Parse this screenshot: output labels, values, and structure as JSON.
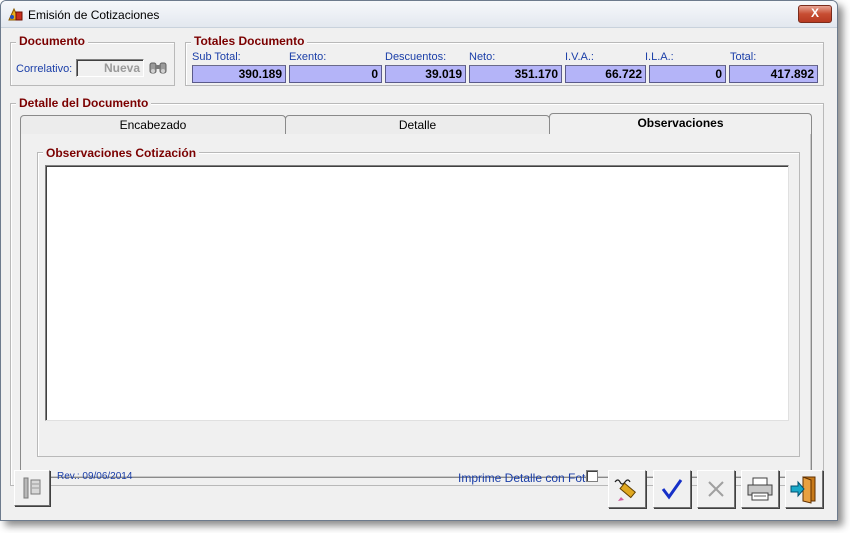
{
  "window": {
    "title": "Emisión de Cotizaciones",
    "close_label": "X"
  },
  "documento": {
    "group_title": "Documento",
    "correlativo_label": "Correlativo:",
    "correlativo_value": "Nueva"
  },
  "totales": {
    "group_title": "Totales Documento",
    "fields": [
      {
        "label": "Sub Total:",
        "value": "390.189"
      },
      {
        "label": "Exento:",
        "value": "0"
      },
      {
        "label": "Descuentos:",
        "value": "39.019"
      },
      {
        "label": "Neto:",
        "value": "351.170"
      },
      {
        "label": "I.V.A.:",
        "value": "66.722"
      },
      {
        "label": "I.L.A.:",
        "value": "0"
      },
      {
        "label": "Total:",
        "value": "417.892"
      }
    ]
  },
  "detalle": {
    "group_title": "Detalle del Documento",
    "tabs": [
      {
        "label": "Encabezado",
        "active": false
      },
      {
        "label": "Detalle",
        "active": false
      },
      {
        "label": "Observaciones",
        "active": true
      }
    ],
    "observaciones_title": "Observaciones Cotización",
    "observaciones_text": ""
  },
  "footer": {
    "revision": "Rev.: 09/06/2014",
    "imprime_label": "Imprime Detalle con Foto",
    "imprime_checked": false
  },
  "icons": {
    "app": "app-icon",
    "search": "binoculars-icon",
    "tools": "tools-icon",
    "sign": "signature-icon",
    "confirm": "checkmark-icon",
    "cancel": "x-icon",
    "print": "printer-icon",
    "exit": "exit-door-icon"
  },
  "colors": {
    "group_title": "#7b0000",
    "label_blue": "#1a3ea8",
    "value_bg": "#b4b4f8",
    "confirm_blue": "#1630c8"
  }
}
